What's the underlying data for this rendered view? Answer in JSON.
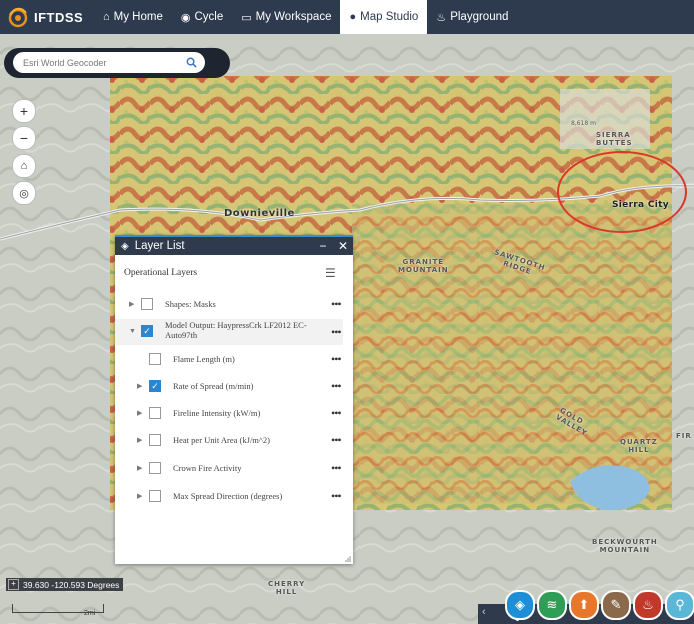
{
  "app": {
    "name": "IFTDSS"
  },
  "nav": [
    {
      "label": "My Home",
      "icon": "home-icon",
      "glyph": "⌂"
    },
    {
      "label": "Cycle",
      "icon": "cycle-icon",
      "glyph": "◉"
    },
    {
      "label": "My Workspace",
      "icon": "workspace-icon",
      "glyph": "▭"
    },
    {
      "label": "Map Studio",
      "icon": "globe-icon",
      "glyph": "●"
    },
    {
      "label": "Playground",
      "icon": "flame-icon",
      "glyph": "♨"
    }
  ],
  "search": {
    "placeholder": "Esri World Geocoder"
  },
  "map_labels": {
    "downieville": "Downieville",
    "sierra_city": "Sierra City",
    "sierra_buttes": "SIERRA\nBUTTES",
    "granite_mountain": "GRANITE\nMOUNTAIN",
    "sawtooth_ridge": "SAWTOOTH\nRIDGE",
    "gold_valley": "GOLD\nVALLEY",
    "quartz_hill": "QUARTZ\nHILL",
    "beckwourth_mountain": "BECKWOURTH\nMOUNTAIN",
    "cherry_hill": "CHERRY\nHILL",
    "fir": "FIR",
    "elevation": "8,618 m"
  },
  "layer_list": {
    "title": "Layer List",
    "section": "Operational Layers",
    "layers": [
      {
        "label": "Shapes: Masks",
        "checked": false,
        "expanded": false
      },
      {
        "label": "Model Output: HaypressCrk LF2012 EC-Auto97th",
        "checked": true,
        "expanded": true
      },
      {
        "label": "Flame Length (m)",
        "checked": false
      },
      {
        "label": "Rate of Spread (m/min)",
        "checked": true
      },
      {
        "label": "Fireline Intensity (kW/m)",
        "checked": false
      },
      {
        "label": "Heat per Unit Area (kJ/m^2)",
        "checked": false
      },
      {
        "label": "Crown Fire Activity",
        "checked": false
      },
      {
        "label": "Max Spread Direction (degrees)",
        "checked": false
      }
    ]
  },
  "coordinates": "39.630 -120.593 Degrees",
  "scale_label": "2mi",
  "dock": [
    {
      "name": "layer-list-icon",
      "color": "#1e8fd6"
    },
    {
      "name": "basemap-icon",
      "color": "#2e9e56"
    },
    {
      "name": "upload-icon",
      "color": "#e8772a"
    },
    {
      "name": "edit-icon",
      "color": "#8b6a4c"
    },
    {
      "name": "fire-icon",
      "color": "#c0392b"
    },
    {
      "name": "location-icon",
      "color": "#5bb7d6"
    }
  ]
}
